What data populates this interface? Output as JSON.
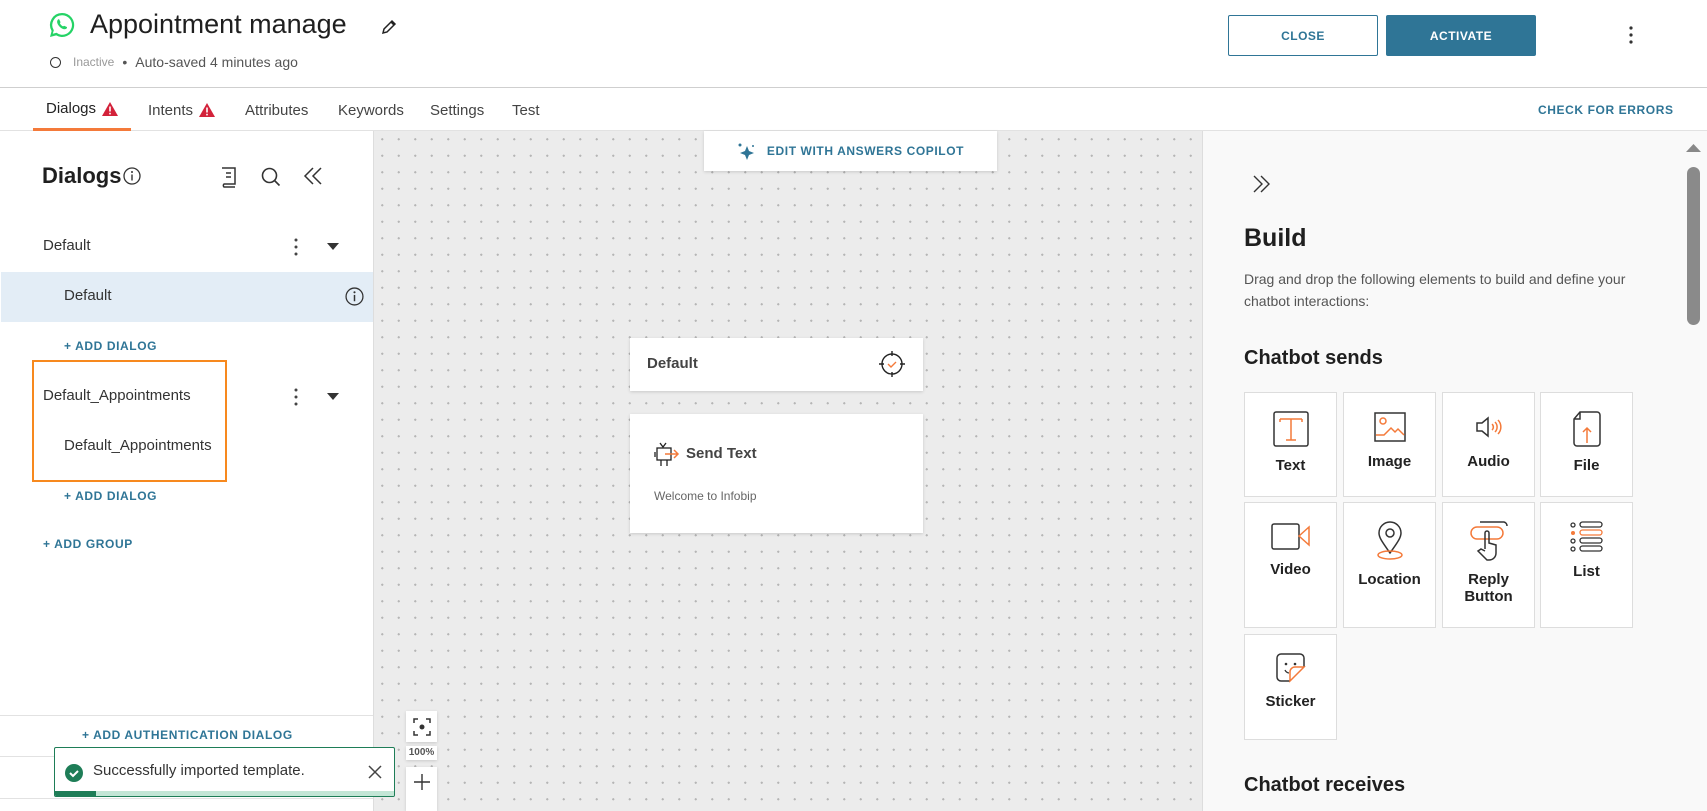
{
  "header": {
    "title": "Appointment manage",
    "status": "Inactive",
    "autosave": "Auto-saved 4 minutes ago",
    "close_label": "CLOSE",
    "activate_label": "ACTIVATE"
  },
  "tabs": [
    {
      "label": "Dialogs",
      "warning": true
    },
    {
      "label": "Intents",
      "warning": true
    },
    {
      "label": "Attributes"
    },
    {
      "label": "Keywords"
    },
    {
      "label": "Settings"
    },
    {
      "label": "Test"
    }
  ],
  "check_errors": "CHECK FOR ERRORS",
  "sidebar": {
    "title": "Dialogs",
    "groups": [
      {
        "name": "Default",
        "dialogs": [
          "Default"
        ]
      },
      {
        "name": "Default_Appointments",
        "dialogs": [
          "Default_Appointments"
        ]
      }
    ],
    "add_dialog": "+ ADD DIALOG",
    "add_group": "+ ADD GROUP",
    "add_auth": "+ ADD AUTHENTICATION DIALOG"
  },
  "toast": {
    "message": "Successfully imported template.",
    "progress": 0.12
  },
  "canvas": {
    "copilot": "EDIT WITH ANSWERS COPILOT",
    "start_card": "Default",
    "send_title": "Send Text",
    "send_body": "Welcome to Infobip",
    "zoom": "100%"
  },
  "build": {
    "title": "Build",
    "description": "Drag and drop the following elements to build and define your chatbot interactions:",
    "sends_title": "Chatbot sends",
    "elements": [
      "Text",
      "Image",
      "Audio",
      "File",
      "Video",
      "Location",
      "Reply Button",
      "List",
      "Sticker"
    ],
    "receives_title": "Chatbot receives"
  },
  "colors": {
    "accent": "#2f7596",
    "orange": "#f47a3a",
    "warning": "#d3223a",
    "success": "#1e7d57"
  }
}
